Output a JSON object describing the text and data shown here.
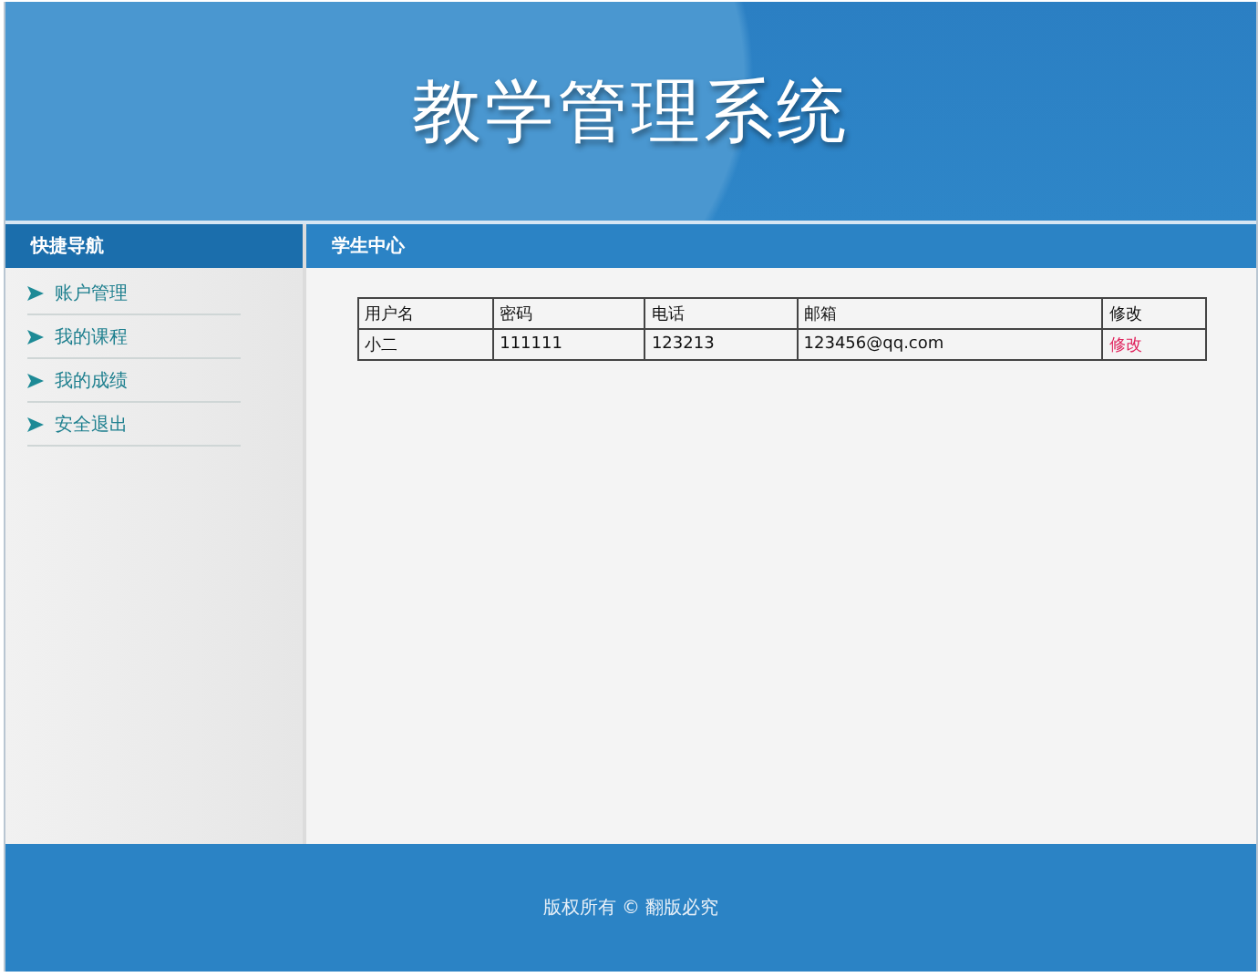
{
  "header": {
    "title": "教学管理系统"
  },
  "sidebar": {
    "title": "快捷导航",
    "items": [
      {
        "label": "账户管理"
      },
      {
        "label": "我的课程"
      },
      {
        "label": "我的成绩"
      },
      {
        "label": "安全退出"
      }
    ]
  },
  "content": {
    "title": "学生中心",
    "table": {
      "columns": [
        "用户名",
        "密码",
        "电话",
        "邮箱",
        "修改"
      ],
      "rows": [
        {
          "cells": [
            "小二",
            "111111",
            "123213",
            "123456@qq.com"
          ],
          "action": "修改"
        }
      ]
    }
  },
  "footer": {
    "text": "版权所有 © 翻版必究"
  }
}
